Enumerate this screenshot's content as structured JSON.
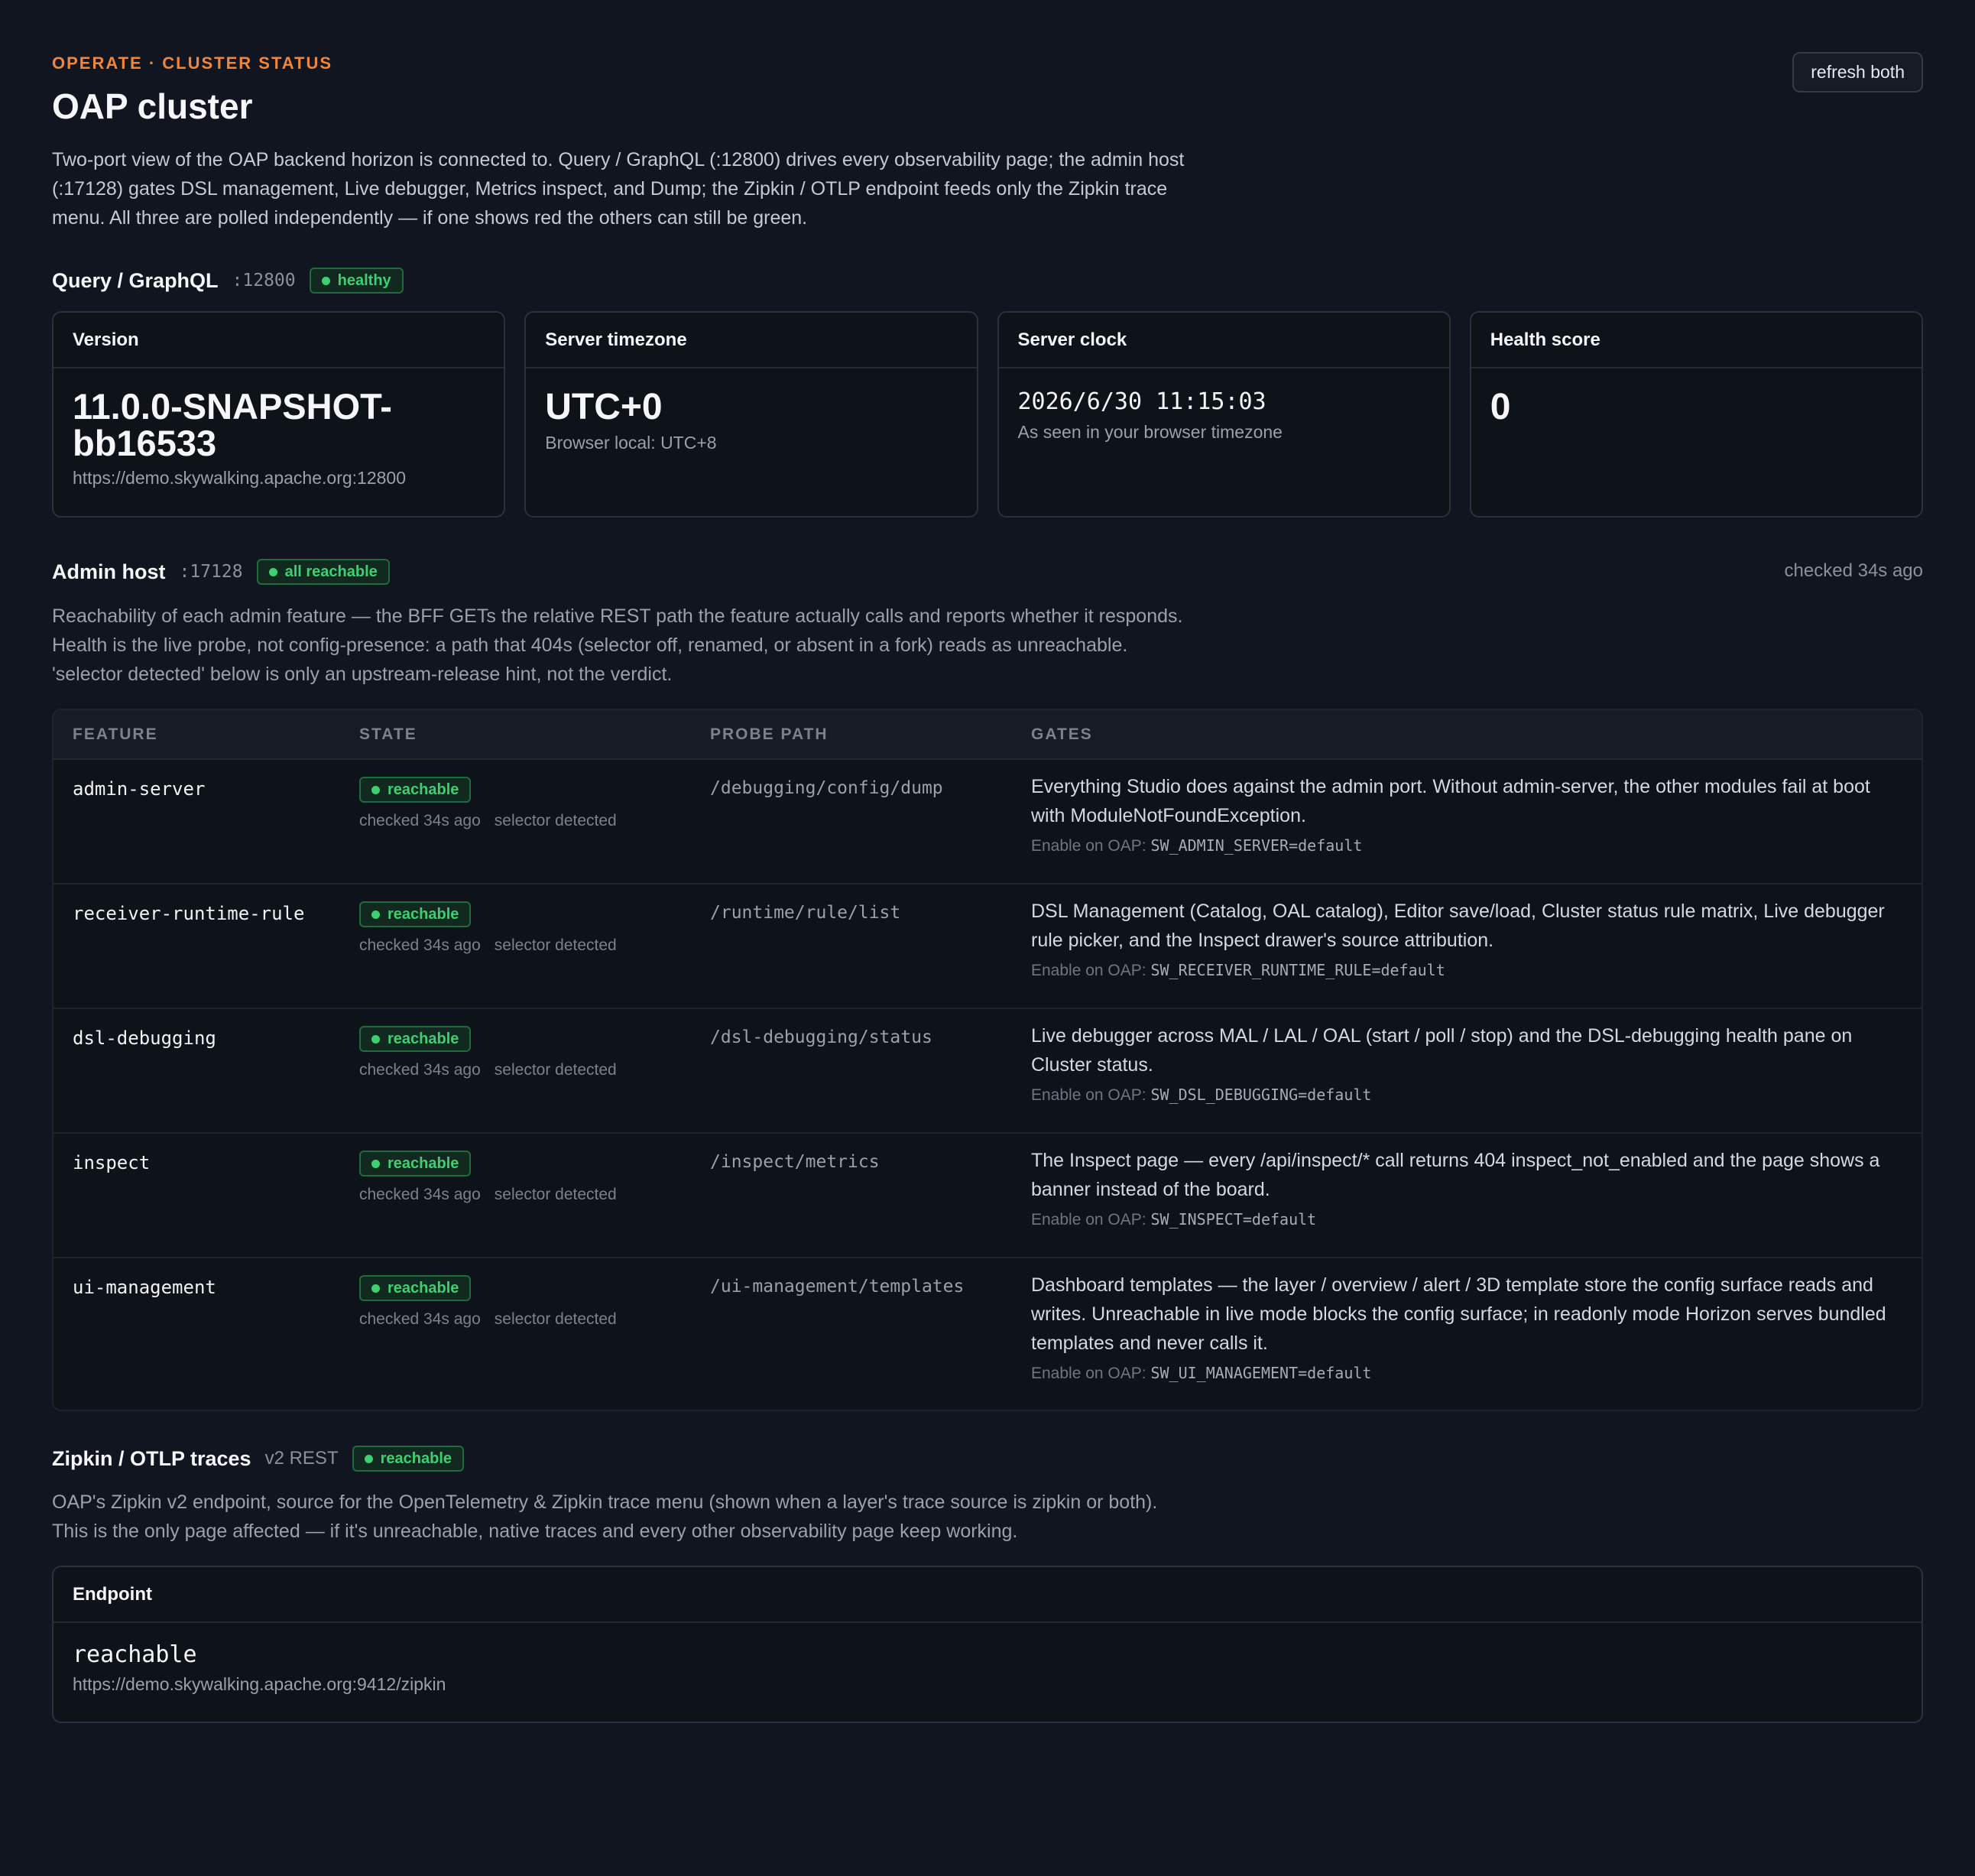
{
  "header": {
    "eyebrow": "OPERATE · CLUSTER STATUS",
    "title": "OAP cluster",
    "refresh_label": "refresh both",
    "intro": "Two-port view of the OAP backend horizon is connected to. Query / GraphQL (:12800) drives every observability page; the admin host (:17128) gates DSL management, Live debugger, Metrics inspect, and Dump; the Zipkin / OTLP endpoint feeds only the Zipkin trace menu. All three are polled independently — if one shows red the others can still be green."
  },
  "query": {
    "title": "Query / GraphQL",
    "port": ":12800",
    "badge": "healthy",
    "cards": [
      {
        "label": "Version",
        "value": "11.0.0-SNAPSHOT-bb16533",
        "sub": "https://demo.skywalking.apache.org:12800"
      },
      {
        "label": "Server timezone",
        "value": "UTC+0",
        "sub": "Browser local: UTC+8"
      },
      {
        "label": "Server clock",
        "value": "2026/6/30 11:15:03",
        "sub": "As seen in your browser timezone"
      },
      {
        "label": "Health score",
        "value": "0",
        "sub": ""
      }
    ]
  },
  "admin": {
    "title": "Admin host",
    "port": ":17128",
    "badge": "all reachable",
    "checked": "checked 34s ago",
    "description": "Reachability of each admin feature — the BFF GETs the relative REST path the feature actually calls and reports whether it responds. Health is the live probe, not config-presence: a path that 404s (selector off, renamed, or absent in a fork) reads as unreachable. 'selector detected' below is only an upstream-release hint, not the verdict.",
    "columns": [
      "FEATURE",
      "STATE",
      "PROBE PATH",
      "GATES"
    ],
    "enable_prefix": "Enable on OAP:",
    "rows": [
      {
        "feature": "admin-server",
        "state": "reachable",
        "checked": "checked 34s ago",
        "selector": "selector detected",
        "probe": "/debugging/config/dump",
        "gates": "Everything Studio does against the admin port. Without admin-server, the other modules fail at boot with ModuleNotFoundException.",
        "env": "SW_ADMIN_SERVER=default"
      },
      {
        "feature": "receiver-runtime-rule",
        "state": "reachable",
        "checked": "checked 34s ago",
        "selector": "selector detected",
        "probe": "/runtime/rule/list",
        "gates": "DSL Management (Catalog, OAL catalog), Editor save/load, Cluster status rule matrix, Live debugger rule picker, and the Inspect drawer's source attribution.",
        "env": "SW_RECEIVER_RUNTIME_RULE=default"
      },
      {
        "feature": "dsl-debugging",
        "state": "reachable",
        "checked": "checked 34s ago",
        "selector": "selector detected",
        "probe": "/dsl-debugging/status",
        "gates": "Live debugger across MAL / LAL / OAL (start / poll / stop) and the DSL-debugging health pane on Cluster status.",
        "env": "SW_DSL_DEBUGGING=default"
      },
      {
        "feature": "inspect",
        "state": "reachable",
        "checked": "checked 34s ago",
        "selector": "selector detected",
        "probe": "/inspect/metrics",
        "gates": "The Inspect page — every /api/inspect/* call returns 404 inspect_not_enabled and the page shows a banner instead of the board.",
        "env": "SW_INSPECT=default"
      },
      {
        "feature": "ui-management",
        "state": "reachable",
        "checked": "checked 34s ago",
        "selector": "selector detected",
        "probe": "/ui-management/templates",
        "gates": "Dashboard templates — the layer / overview / alert / 3D template store the config surface reads and writes. Unreachable in live mode blocks the config surface; in readonly mode Horizon serves bundled templates and never calls it.",
        "env": "SW_UI_MANAGEMENT=default"
      }
    ]
  },
  "zipkin": {
    "title": "Zipkin / OTLP traces",
    "version": "v2 REST",
    "badge": "reachable",
    "description": "OAP's Zipkin v2 endpoint, source for the OpenTelemetry & Zipkin trace menu (shown when a layer's trace source is zipkin or both). This is the only page affected — if it's unreachable, native traces and every other observability page keep working.",
    "endpoint_label": "Endpoint",
    "endpoint_value": "reachable",
    "endpoint_url": "https://demo.skywalking.apache.org:9412/zipkin"
  }
}
